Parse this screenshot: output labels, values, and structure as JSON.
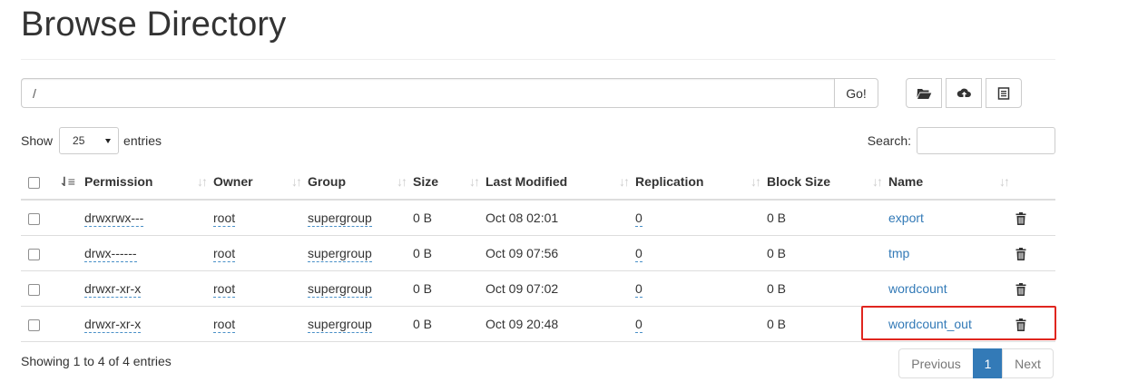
{
  "page": {
    "title": "Browse Directory"
  },
  "path_bar": {
    "value": "/",
    "go_label": "Go!"
  },
  "toolbar": {
    "buttons": [
      {
        "icon": "folder-open-icon"
      },
      {
        "icon": "cloud-upload-icon"
      },
      {
        "icon": "list-icon"
      }
    ]
  },
  "length": {
    "show_label": "Show",
    "selected": "25",
    "entries_label": "entries"
  },
  "search": {
    "label": "Search:",
    "value": ""
  },
  "table": {
    "headers": [
      "Permission",
      "Owner",
      "Group",
      "Size",
      "Last Modified",
      "Replication",
      "Block Size",
      "Name"
    ],
    "rows": [
      {
        "permission": "drwxrwx---",
        "owner": "root",
        "group": "supergroup",
        "size": "0 B",
        "modified": "Oct 08 02:01",
        "replication": "0",
        "block_size": "0 B",
        "name": "export"
      },
      {
        "permission": "drwx------",
        "owner": "root",
        "group": "supergroup",
        "size": "0 B",
        "modified": "Oct 09 07:56",
        "replication": "0",
        "block_size": "0 B",
        "name": "tmp"
      },
      {
        "permission": "drwxr-xr-x",
        "owner": "root",
        "group": "supergroup",
        "size": "0 B",
        "modified": "Oct 09 07:02",
        "replication": "0",
        "block_size": "0 B",
        "name": "wordcount"
      },
      {
        "permission": "drwxr-xr-x",
        "owner": "root",
        "group": "supergroup",
        "size": "0 B",
        "modified": "Oct 09 20:48",
        "replication": "0",
        "block_size": "0 B",
        "name": "wordcount_out"
      }
    ]
  },
  "footer": {
    "info": "Showing 1 to 4 of 4 entries",
    "previous": "Previous",
    "current_page": "1",
    "next": "Next"
  },
  "colors": {
    "link": "#337ab7",
    "highlight": "#e0261f",
    "active_page": "#337ab7"
  }
}
